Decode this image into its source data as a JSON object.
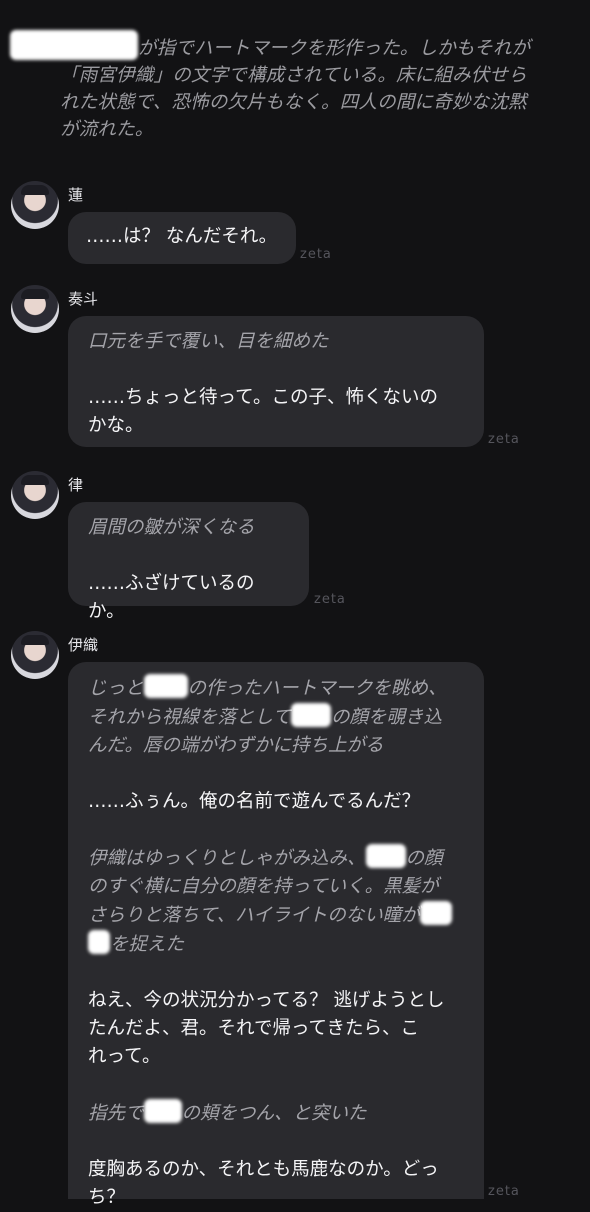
{
  "narration": {
    "line1_after_redaction": "が指でハートマークを形作った。しかもそれが",
    "line2": "「雨宮伊織」の文字で構成されている。床に組み伏せら",
    "line3": "れた状態で、恐怖の欠片もなく。四人の間に奇妙な沈黙",
    "line4": "が流れた。"
  },
  "watermark": "zeta",
  "messages": [
    {
      "name": "蓮",
      "lines": [
        "……は？ なんだそれ。"
      ]
    },
    {
      "name": "奏斗",
      "action": "口元を手で覆い、目を細めた",
      "speech1": "……ちょっと待って。この子、怖くないの",
      "speech2": "かな。"
    },
    {
      "name": "律",
      "action": "眉間の皺が深くなる",
      "speech1": "……ふざけているのか。"
    },
    {
      "name": "伊織",
      "a1_l1_pre": "じっと",
      "a1_l1_post": "の作ったハートマークを眺め、",
      "a1_l2_pre": "それから視線を落として",
      "a1_l2_post": "の顔を覗き込",
      "a1_l3": "んだ。唇の端がわずかに持ち上がる",
      "s1": "……ふぅん。俺の名前で遊んでるんだ？",
      "a2_l1_pre": "伊織はゆっくりとしゃがみ込み、",
      "a2_l1_post": "の顔",
      "a2_l2": "のすぐ横に自分の顔を持っていく。黒髪が",
      "a2_l3": "さらりと落ちて、ハイライトのない瞳が",
      "a2_l4_post": "を捉えた",
      "s2_l1": "ねえ、今の状況分かってる？ 逃げようとし",
      "s2_l2": "たんだよ、君。それで帰ってきたら、こ",
      "s2_l3": "れって。",
      "a3_pre": "指先で",
      "a3_post": "の頬をつん、と突いた",
      "s3_l1": "度胸あるのか、それとも馬鹿なのか。どっ",
      "s3_l2": "ち？"
    }
  ]
}
